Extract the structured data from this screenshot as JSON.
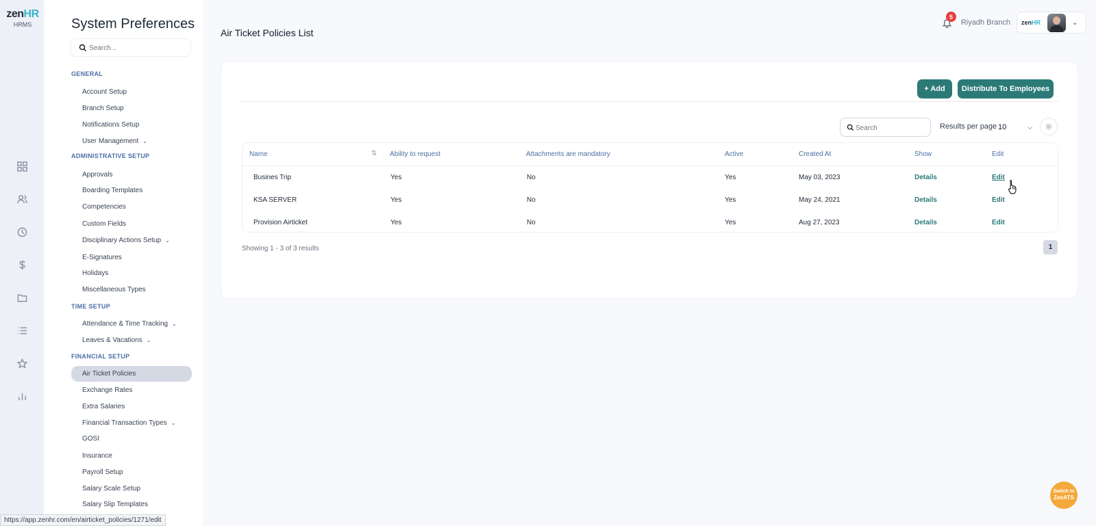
{
  "app": {
    "logo_text_a": "zen",
    "logo_text_b": "HR",
    "logo_sub": "HRMS"
  },
  "rail_icons": [
    "dashboard-icon",
    "users-icon",
    "clock-icon",
    "dollar-icon",
    "folder-icon",
    "list-icon",
    "star-icon",
    "bar-chart-icon"
  ],
  "settings": {
    "title": "System Preferences",
    "search_placeholder": "Search...",
    "sections": [
      {
        "label": "GENERAL",
        "items": [
          {
            "label": "Account Setup"
          },
          {
            "label": "Branch Setup"
          },
          {
            "label": "Notifications Setup"
          },
          {
            "label": "User Management",
            "expandable": true
          }
        ]
      },
      {
        "label": "ADMINISTRATIVE SETUP",
        "items": [
          {
            "label": "Approvals"
          },
          {
            "label": "Boarding Templates"
          },
          {
            "label": "Competencies"
          },
          {
            "label": "Custom Fields"
          },
          {
            "label": "Disciplinary Actions Setup",
            "expandable": true
          },
          {
            "label": "E-Signatures"
          },
          {
            "label": "Holidays"
          },
          {
            "label": "Miscellaneous Types"
          }
        ]
      },
      {
        "label": "TIME SETUP",
        "items": [
          {
            "label": "Attendance & Time Tracking",
            "expandable": true
          },
          {
            "label": "Leaves & Vacations",
            "expandable": true
          }
        ]
      },
      {
        "label": "FINANCIAL SETUP",
        "items": [
          {
            "label": "Air Ticket Policies",
            "active": true
          },
          {
            "label": "Exchange Rates"
          },
          {
            "label": "Extra Salaries"
          },
          {
            "label": "Financial Transaction Types",
            "expandable": true
          },
          {
            "label": "GOSI"
          },
          {
            "label": "Insurance"
          },
          {
            "label": "Payroll Setup"
          },
          {
            "label": "Salary Scale Setup"
          },
          {
            "label": "Salary Slip Templates"
          }
        ]
      }
    ]
  },
  "topbar": {
    "notification_count": "5",
    "branch": "Riyadh Branch",
    "mini_logo_a": "zen",
    "mini_logo_b": "HR"
  },
  "main": {
    "title": "Air Ticket Policies List",
    "add_label": "+ Add",
    "distribute_label": "Distribute To Employees",
    "search_placeholder": "Search",
    "results_per_page_label": "Results per page",
    "results_per_page_value": "10",
    "table": {
      "headers": [
        "Name",
        "Ability to request",
        "Attachments are mandatory",
        "Active",
        "Created At",
        "Show",
        "Edit"
      ],
      "rows": [
        [
          "Busines Trip",
          "Yes",
          "No",
          "Yes",
          "May 03, 2023",
          "Details",
          "Edit"
        ],
        [
          "KSA SERVER",
          "Yes",
          "No",
          "Yes",
          "May 24, 2021",
          "Details",
          "Edit"
        ],
        [
          "Provision Airticket",
          "Yes",
          "No",
          "Yes",
          "Aug 27, 2023",
          "Details",
          "Edit"
        ]
      ]
    },
    "showing_text": "Showing 1 - 3 of 3 results",
    "current_page": "1"
  },
  "status_url": "https://app.zenhr.com/en/airticket_policies/1271/edit",
  "switch_ats": {
    "line1": "Switch to",
    "line2": "ZenATS"
  }
}
